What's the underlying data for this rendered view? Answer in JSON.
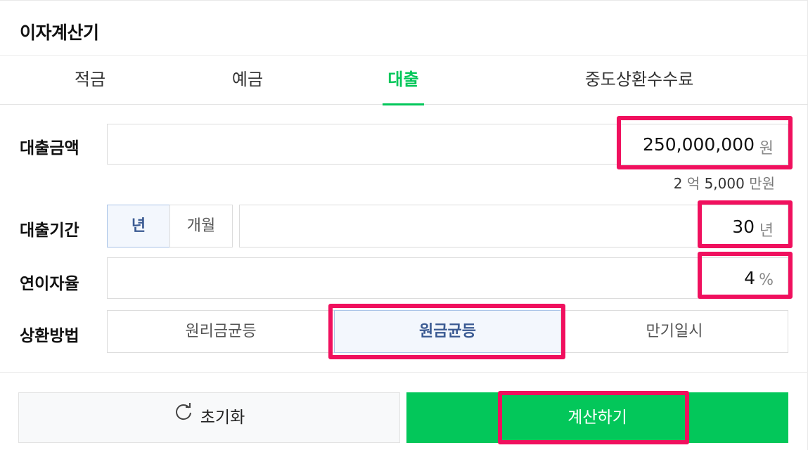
{
  "header": {
    "title": "이자계산기"
  },
  "tabs": [
    {
      "label": "적금"
    },
    {
      "label": "예금"
    },
    {
      "label": "대출"
    },
    {
      "label": "중도상환수수료"
    }
  ],
  "loan_amount": {
    "label": "대출금액",
    "value": "250,000,000",
    "unit": "원",
    "hint_num1": "2",
    "hint_unit1": "억",
    "hint_num2": "5,000",
    "hint_unit2": "만원"
  },
  "loan_period": {
    "label": "대출기간",
    "options": [
      "년",
      "개월"
    ],
    "selected": "년",
    "value": "30",
    "unit": "년"
  },
  "interest_rate": {
    "label": "연이자율",
    "value": "4",
    "unit": "%"
  },
  "repayment": {
    "label": "상환방법",
    "options": [
      "원리금균등",
      "원금균등",
      "만기일시"
    ],
    "selected": "원금균등"
  },
  "actions": {
    "reset_label": "초기화",
    "calculate_label": "계산하기"
  },
  "colors": {
    "accent": "#03c75a",
    "highlight": "#f0105e",
    "selected_text": "#3a5a92"
  }
}
